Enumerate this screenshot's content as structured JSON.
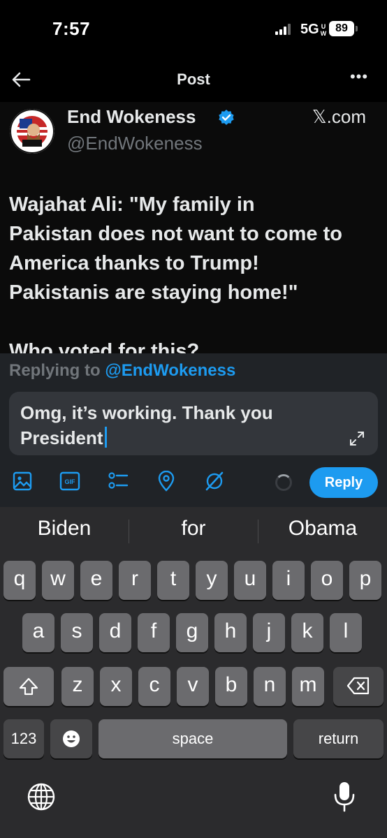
{
  "status_bar": {
    "time": "7:57",
    "network": "5G",
    "network_suffix": "UW",
    "battery": "89"
  },
  "header": {
    "title": "Post",
    "back_icon": "arrow-left-icon",
    "more_icon": "more-horizontal-icon",
    "more_label": "•••"
  },
  "post": {
    "author_name": "End Wokeness",
    "handle": "@EndWokeness",
    "source": "𝕏.com",
    "avatar_lettering": "I SUPPORT THE FORMER THINGS",
    "text": "Wajahat Ali: \"My family in\nPakistan does not want to come to\nAmerica thanks to Trump!\nPakistanis are staying home!\"\n\nWho voted for this?"
  },
  "reply": {
    "replying_prefix": "Replying to",
    "replying_handle": "@EndWokeness",
    "input_text": "Omg, it’s working. Thank you President",
    "button_label": "Reply",
    "tools": [
      "image-icon",
      "gif-icon",
      "poll-icon",
      "location-icon",
      "grok-icon"
    ],
    "gif_label": "GIF",
    "colors": {
      "accent": "#1d9bf0",
      "panel": "#202327",
      "input": "#33363b"
    }
  },
  "keyboard": {
    "suggestions": [
      "Biden",
      "for",
      "Obama"
    ],
    "row1": [
      "q",
      "w",
      "e",
      "r",
      "t",
      "y",
      "u",
      "i",
      "o",
      "p"
    ],
    "row2": [
      "a",
      "s",
      "d",
      "f",
      "g",
      "h",
      "j",
      "k",
      "l"
    ],
    "row3": [
      "z",
      "x",
      "c",
      "v",
      "b",
      "n",
      "m"
    ],
    "numbers_label": "123",
    "space_label": "space",
    "return_label": "return"
  }
}
